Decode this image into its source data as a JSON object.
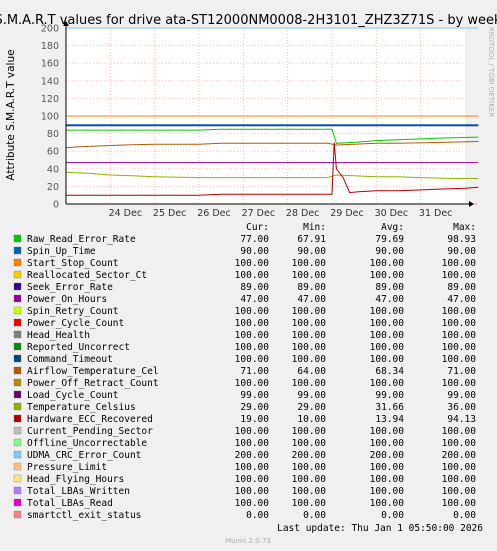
{
  "chart_data": {
    "type": "line",
    "title": "S.M.A.R.T values for drive ata-ST12000NM0008-2H3101_ZHZ3Z71S - by week",
    "ylabel": "Attribute S.M.A.R.T value",
    "ylim": [
      0,
      200
    ],
    "yticks": [
      0,
      20,
      40,
      60,
      80,
      100,
      120,
      140,
      160,
      180,
      200
    ],
    "xlim": [
      "2025-12-23",
      "2026-01-01"
    ],
    "xticks": [
      {
        "date": "2025-12-24",
        "label": "24 Dec"
      },
      {
        "date": "2025-12-25",
        "label": "25 Dec"
      },
      {
        "date": "2025-12-26",
        "label": "26 Dec"
      },
      {
        "date": "2025-12-27",
        "label": "27 Dec"
      },
      {
        "date": "2025-12-28",
        "label": "28 Dec"
      },
      {
        "date": "2025-12-29",
        "label": "29 Dec"
      },
      {
        "date": "2025-12-30",
        "label": "30 Dec"
      },
      {
        "date": "2025-12-31",
        "label": "31 Dec"
      }
    ],
    "grid": true,
    "watermark": "RRDTOOL / TOBI OETIKER",
    "columns": [
      "Cur:",
      "Min:",
      "Avg:",
      "Max:"
    ],
    "series": [
      {
        "name": "Raw_Read_Error_Rate",
        "color": "#00cc00",
        "cur": "77.00",
        "min": "67.91",
        "avg": "79.69",
        "max": "98.93"
      },
      {
        "name": "Spin_Up_Time",
        "color": "#0066b3",
        "cur": "90.00",
        "min": "90.00",
        "avg": "90.00",
        "max": "90.00"
      },
      {
        "name": "Start_Stop_Count",
        "color": "#ff8000",
        "cur": "100.00",
        "min": "100.00",
        "avg": "100.00",
        "max": "100.00"
      },
      {
        "name": "Reallocated_Sector_Ct",
        "color": "#ffcc00",
        "cur": "100.00",
        "min": "100.00",
        "avg": "100.00",
        "max": "100.00"
      },
      {
        "name": "Seek_Error_Rate",
        "color": "#330099",
        "cur": "89.00",
        "min": "89.00",
        "avg": "89.00",
        "max": "89.00"
      },
      {
        "name": "Power_On_Hours",
        "color": "#990099",
        "cur": "47.00",
        "min": "47.00",
        "avg": "47.00",
        "max": "47.00"
      },
      {
        "name": "Spin_Retry_Count",
        "color": "#ccff00",
        "cur": "100.00",
        "min": "100.00",
        "avg": "100.00",
        "max": "100.00"
      },
      {
        "name": "Power_Cycle_Count",
        "color": "#ff0000",
        "cur": "100.00",
        "min": "100.00",
        "avg": "100.00",
        "max": "100.00"
      },
      {
        "name": "Head_Health",
        "color": "#808080",
        "cur": "100.00",
        "min": "100.00",
        "avg": "100.00",
        "max": "100.00"
      },
      {
        "name": "Reported_Uncorrect",
        "color": "#008f00",
        "cur": "100.00",
        "min": "100.00",
        "avg": "100.00",
        "max": "100.00"
      },
      {
        "name": "Command_Timeout",
        "color": "#00487d",
        "cur": "100.00",
        "min": "100.00",
        "avg": "100.00",
        "max": "100.00"
      },
      {
        "name": "Airflow_Temperature_Cel",
        "color": "#b35a00",
        "cur": "71.00",
        "min": "64.00",
        "avg": "68.34",
        "max": "71.00"
      },
      {
        "name": "Power_Off_Retract_Count",
        "color": "#b38f00",
        "cur": "100.00",
        "min": "100.00",
        "avg": "100.00",
        "max": "100.00"
      },
      {
        "name": "Load_Cycle_Count",
        "color": "#6b006b",
        "cur": "99.00",
        "min": "99.00",
        "avg": "99.00",
        "max": "99.00"
      },
      {
        "name": "Temperature_Celsius",
        "color": "#8fb300",
        "cur": "29.00",
        "min": "29.00",
        "avg": "31.66",
        "max": "36.00"
      },
      {
        "name": "Hardware_ECC_Recovered",
        "color": "#b30000",
        "cur": "19.00",
        "min": "10.00",
        "avg": "13.94",
        "max": "94.13"
      },
      {
        "name": "Current_Pending_Sector",
        "color": "#bebebe",
        "cur": "100.00",
        "min": "100.00",
        "avg": "100.00",
        "max": "100.00"
      },
      {
        "name": "Offline_Uncorrectable",
        "color": "#80ff80",
        "cur": "100.00",
        "min": "100.00",
        "avg": "100.00",
        "max": "100.00"
      },
      {
        "name": "UDMA_CRC_Error_Count",
        "color": "#80c9ff",
        "cur": "200.00",
        "min": "200.00",
        "avg": "200.00",
        "max": "200.00"
      },
      {
        "name": "Pressure_Limit",
        "color": "#ffc080",
        "cur": "100.00",
        "min": "100.00",
        "avg": "100.00",
        "max": "100.00"
      },
      {
        "name": "Head_Flying_Hours",
        "color": "#ffe680",
        "cur": "100.00",
        "min": "100.00",
        "avg": "100.00",
        "max": "100.00"
      },
      {
        "name": "Total_LBAs_Written",
        "color": "#aa80ff",
        "cur": "100.00",
        "min": "100.00",
        "avg": "100.00",
        "max": "100.00"
      },
      {
        "name": "Total_LBAs_Read",
        "color": "#ee00cc",
        "cur": "100.00",
        "min": "100.00",
        "avg": "100.00",
        "max": "100.00"
      },
      {
        "name": "smartctl_exit_status",
        "color": "#ff8080",
        "cur": "0.00",
        "min": "0.00",
        "avg": "0.00",
        "max": "0.00"
      }
    ],
    "lines": [
      {
        "name": "UDMA_CRC_Error_Count",
        "points": [
          [
            0,
            200
          ],
          [
            9.3,
            200
          ]
        ]
      },
      {
        "name": "Raw_Read_Error_Rate",
        "points": [
          [
            0,
            84
          ],
          [
            3.0,
            84
          ],
          [
            3.5,
            85
          ],
          [
            5.9,
            85
          ],
          [
            6.0,
            85
          ],
          [
            6.1,
            69
          ],
          [
            6.5,
            70
          ],
          [
            7.0,
            72
          ],
          [
            7.5,
            73
          ],
          [
            8.0,
            74
          ],
          [
            8.5,
            75
          ],
          [
            9.3,
            76
          ]
        ]
      },
      {
        "name": "Start_Stop_Count",
        "points": [
          [
            0,
            100
          ],
          [
            9.3,
            100
          ]
        ]
      },
      {
        "name": "Spin_Up_Time",
        "points": [
          [
            0,
            90
          ],
          [
            9.3,
            90
          ]
        ]
      },
      {
        "name": "Seek_Error_Rate",
        "points": [
          [
            0,
            89
          ],
          [
            9.3,
            89
          ]
        ]
      },
      {
        "name": "Airflow_Temperature_Cel",
        "points": [
          [
            0,
            64
          ],
          [
            0.3,
            65
          ],
          [
            0.8,
            66
          ],
          [
            1.3,
            67
          ],
          [
            2.0,
            68
          ],
          [
            3.0,
            68
          ],
          [
            3.5,
            69
          ],
          [
            5.9,
            69
          ],
          [
            6.1,
            67
          ],
          [
            6.5,
            68
          ],
          [
            7.0,
            69
          ],
          [
            7.5,
            69
          ],
          [
            8.5,
            70
          ],
          [
            9.3,
            71
          ]
        ]
      },
      {
        "name": "Power_On_Hours",
        "points": [
          [
            0,
            47
          ],
          [
            9.3,
            47
          ]
        ]
      },
      {
        "name": "Temperature_Celsius",
        "points": [
          [
            0,
            36
          ],
          [
            0.5,
            35
          ],
          [
            1.0,
            33
          ],
          [
            1.5,
            32
          ],
          [
            2.0,
            31
          ],
          [
            3.0,
            30
          ],
          [
            4.0,
            30
          ],
          [
            5.0,
            30
          ],
          [
            5.9,
            30
          ],
          [
            6.1,
            33
          ],
          [
            6.5,
            32
          ],
          [
            7.0,
            31
          ],
          [
            7.5,
            31
          ],
          [
            8.0,
            30
          ],
          [
            8.7,
            29
          ],
          [
            9.3,
            29
          ]
        ]
      },
      {
        "name": "Hardware_ECC_Recovered",
        "points": [
          [
            0,
            10
          ],
          [
            3.0,
            10
          ],
          [
            3.5,
            11
          ],
          [
            5.9,
            11
          ],
          [
            6.0,
            11
          ],
          [
            6.05,
            70
          ],
          [
            6.1,
            40
          ],
          [
            6.25,
            30
          ],
          [
            6.4,
            13
          ],
          [
            6.6,
            14
          ],
          [
            7.0,
            15
          ],
          [
            7.5,
            15
          ],
          [
            8.0,
            16
          ],
          [
            8.5,
            17
          ],
          [
            9.0,
            18
          ],
          [
            9.3,
            19
          ]
        ]
      },
      {
        "name": "smartctl_exit_status",
        "points": [
          [
            0,
            0
          ],
          [
            9.3,
            0
          ]
        ],
        "dashed": true
      }
    ],
    "footer": "Last update: Thu Jan  1 05:50:00 2026",
    "version": "Munin 2.0.73"
  }
}
